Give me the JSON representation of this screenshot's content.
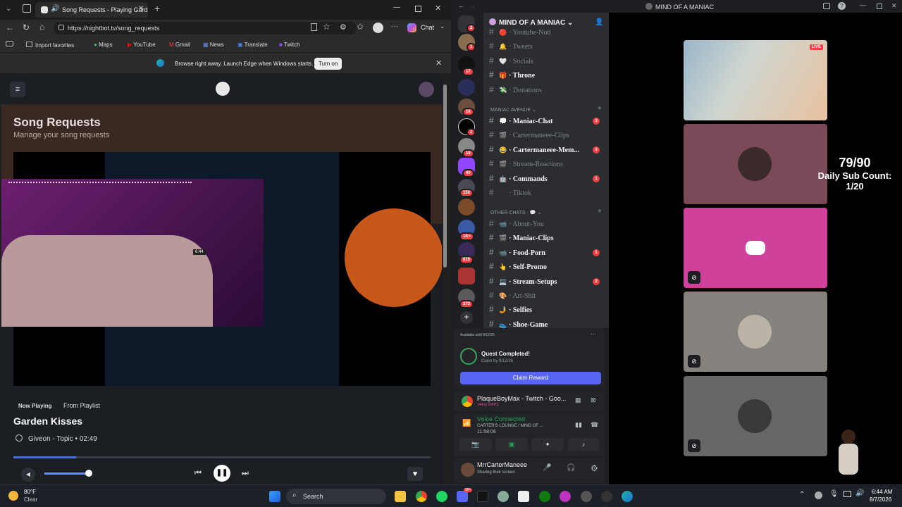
{
  "browser": {
    "tab_title": "Song Requests - Playing Garden Kisses",
    "url": "https://nightbot.tv/song_requests",
    "chat_label": "Chat",
    "favorites": [
      "Import favorites",
      "Maps",
      "YouTube",
      "Gmail",
      "News",
      "Translate",
      "Twitch"
    ],
    "info_message": "Browse right away. Launch Edge when Windows starts.",
    "info_button": "Turn on"
  },
  "nightbot": {
    "title": "Song Requests",
    "subtitle": "Manage your song requests",
    "now_playing_label": "Now Playing",
    "from_playlist_label": "From Playlist",
    "song_title": "Garden Kisses",
    "artist": "Giveon - Topic",
    "duration": "02:49",
    "progress_fraction": 0.15,
    "volume_fraction": 1.0,
    "webcam_clock": "6:44"
  },
  "discord": {
    "window_title": "MIND OF A MANIAC",
    "server_name": "MIND OF A MANIAC",
    "server_badges": [
      "2",
      "1",
      "17",
      "",
      "16",
      "2",
      "19",
      "40",
      "150",
      "",
      "1K+",
      "819",
      "",
      "373"
    ],
    "categories": {
      "avenue": "MANIAC AVENUE",
      "other": "OTHER CHATS"
    },
    "channels_top": [
      {
        "name": "Youtube-Noti",
        "emoji": "🔴",
        "bold": false,
        "badge": ""
      },
      {
        "name": "Tweets",
        "emoji": "🔔",
        "bold": false,
        "badge": ""
      },
      {
        "name": "Socials",
        "emoji": "🤍",
        "bold": false,
        "badge": ""
      },
      {
        "name": "Throne",
        "emoji": "🎁",
        "bold": true,
        "badge": ""
      },
      {
        "name": "Donations",
        "emoji": "💸",
        "bold": false,
        "badge": ""
      }
    ],
    "channels_avenue": [
      {
        "name": "Maniac-Chat",
        "emoji": "💭",
        "bold": true,
        "badge": "3"
      },
      {
        "name": "Cartermaneee-Clips",
        "emoji": "🎬",
        "bold": false,
        "badge": ""
      },
      {
        "name": "Cartermaneee-Mem...",
        "emoji": "😂",
        "bold": true,
        "badge": "3"
      },
      {
        "name": "Stream-Reactions",
        "emoji": "🎬",
        "bold": false,
        "badge": ""
      },
      {
        "name": "Commands",
        "emoji": "🤖",
        "bold": true,
        "badge": "1"
      },
      {
        "name": "Tiktok",
        "emoji": "",
        "bold": false,
        "badge": ""
      }
    ],
    "channels_other": [
      {
        "name": "About-You",
        "emoji": "📹",
        "bold": false,
        "badge": ""
      },
      {
        "name": "Maniac-Clips",
        "emoji": "🎬",
        "bold": true,
        "badge": ""
      },
      {
        "name": "Food-Porn",
        "emoji": "📹",
        "bold": true,
        "badge": "1"
      },
      {
        "name": "Self-Promo",
        "emoji": "👆",
        "bold": true,
        "badge": ""
      },
      {
        "name": "Stream-Setups",
        "emoji": "💻",
        "bold": true,
        "badge": "2"
      },
      {
        "name": "Art-Shit",
        "emoji": "🎨",
        "bold": false,
        "badge": ""
      },
      {
        "name": "Selfies",
        "emoji": "🤳",
        "bold": true,
        "badge": ""
      },
      {
        "name": "Shoe-Game",
        "emoji": "👟",
        "bold": true,
        "badge": ""
      }
    ],
    "quest": {
      "available": "Available until 9/12/26",
      "title": "Quest Completed!",
      "claim_by": "Claim by 9/12/26",
      "button": "Claim Reward"
    },
    "activity": {
      "title": "PlaqueBoyMax - Twitch - Goo...",
      "sub": "1440p 60FPS"
    },
    "voice": {
      "status": "Voice Connected",
      "channel": "CARTER'S LOUNGE / MIND OF ...",
      "timer": "11:58:06"
    },
    "user": {
      "name": "MrrCarterManeee",
      "status": "Sharing their screen"
    },
    "live_badge": "LIVE",
    "overlay_text": [
      "79/90",
      "Daily Sub Count:",
      "1/20"
    ]
  },
  "taskbar": {
    "temp": "80°F",
    "weather": "Clear",
    "search": "Search",
    "time": "6:44 AM",
    "date": "8/7/2026",
    "notif_badge": "99+"
  },
  "colors": {
    "discord_blurple": "#5865f2",
    "discord_pink": "#eb459e",
    "discord_red": "#f23f43",
    "nightbot_banner": "#3a2823"
  }
}
